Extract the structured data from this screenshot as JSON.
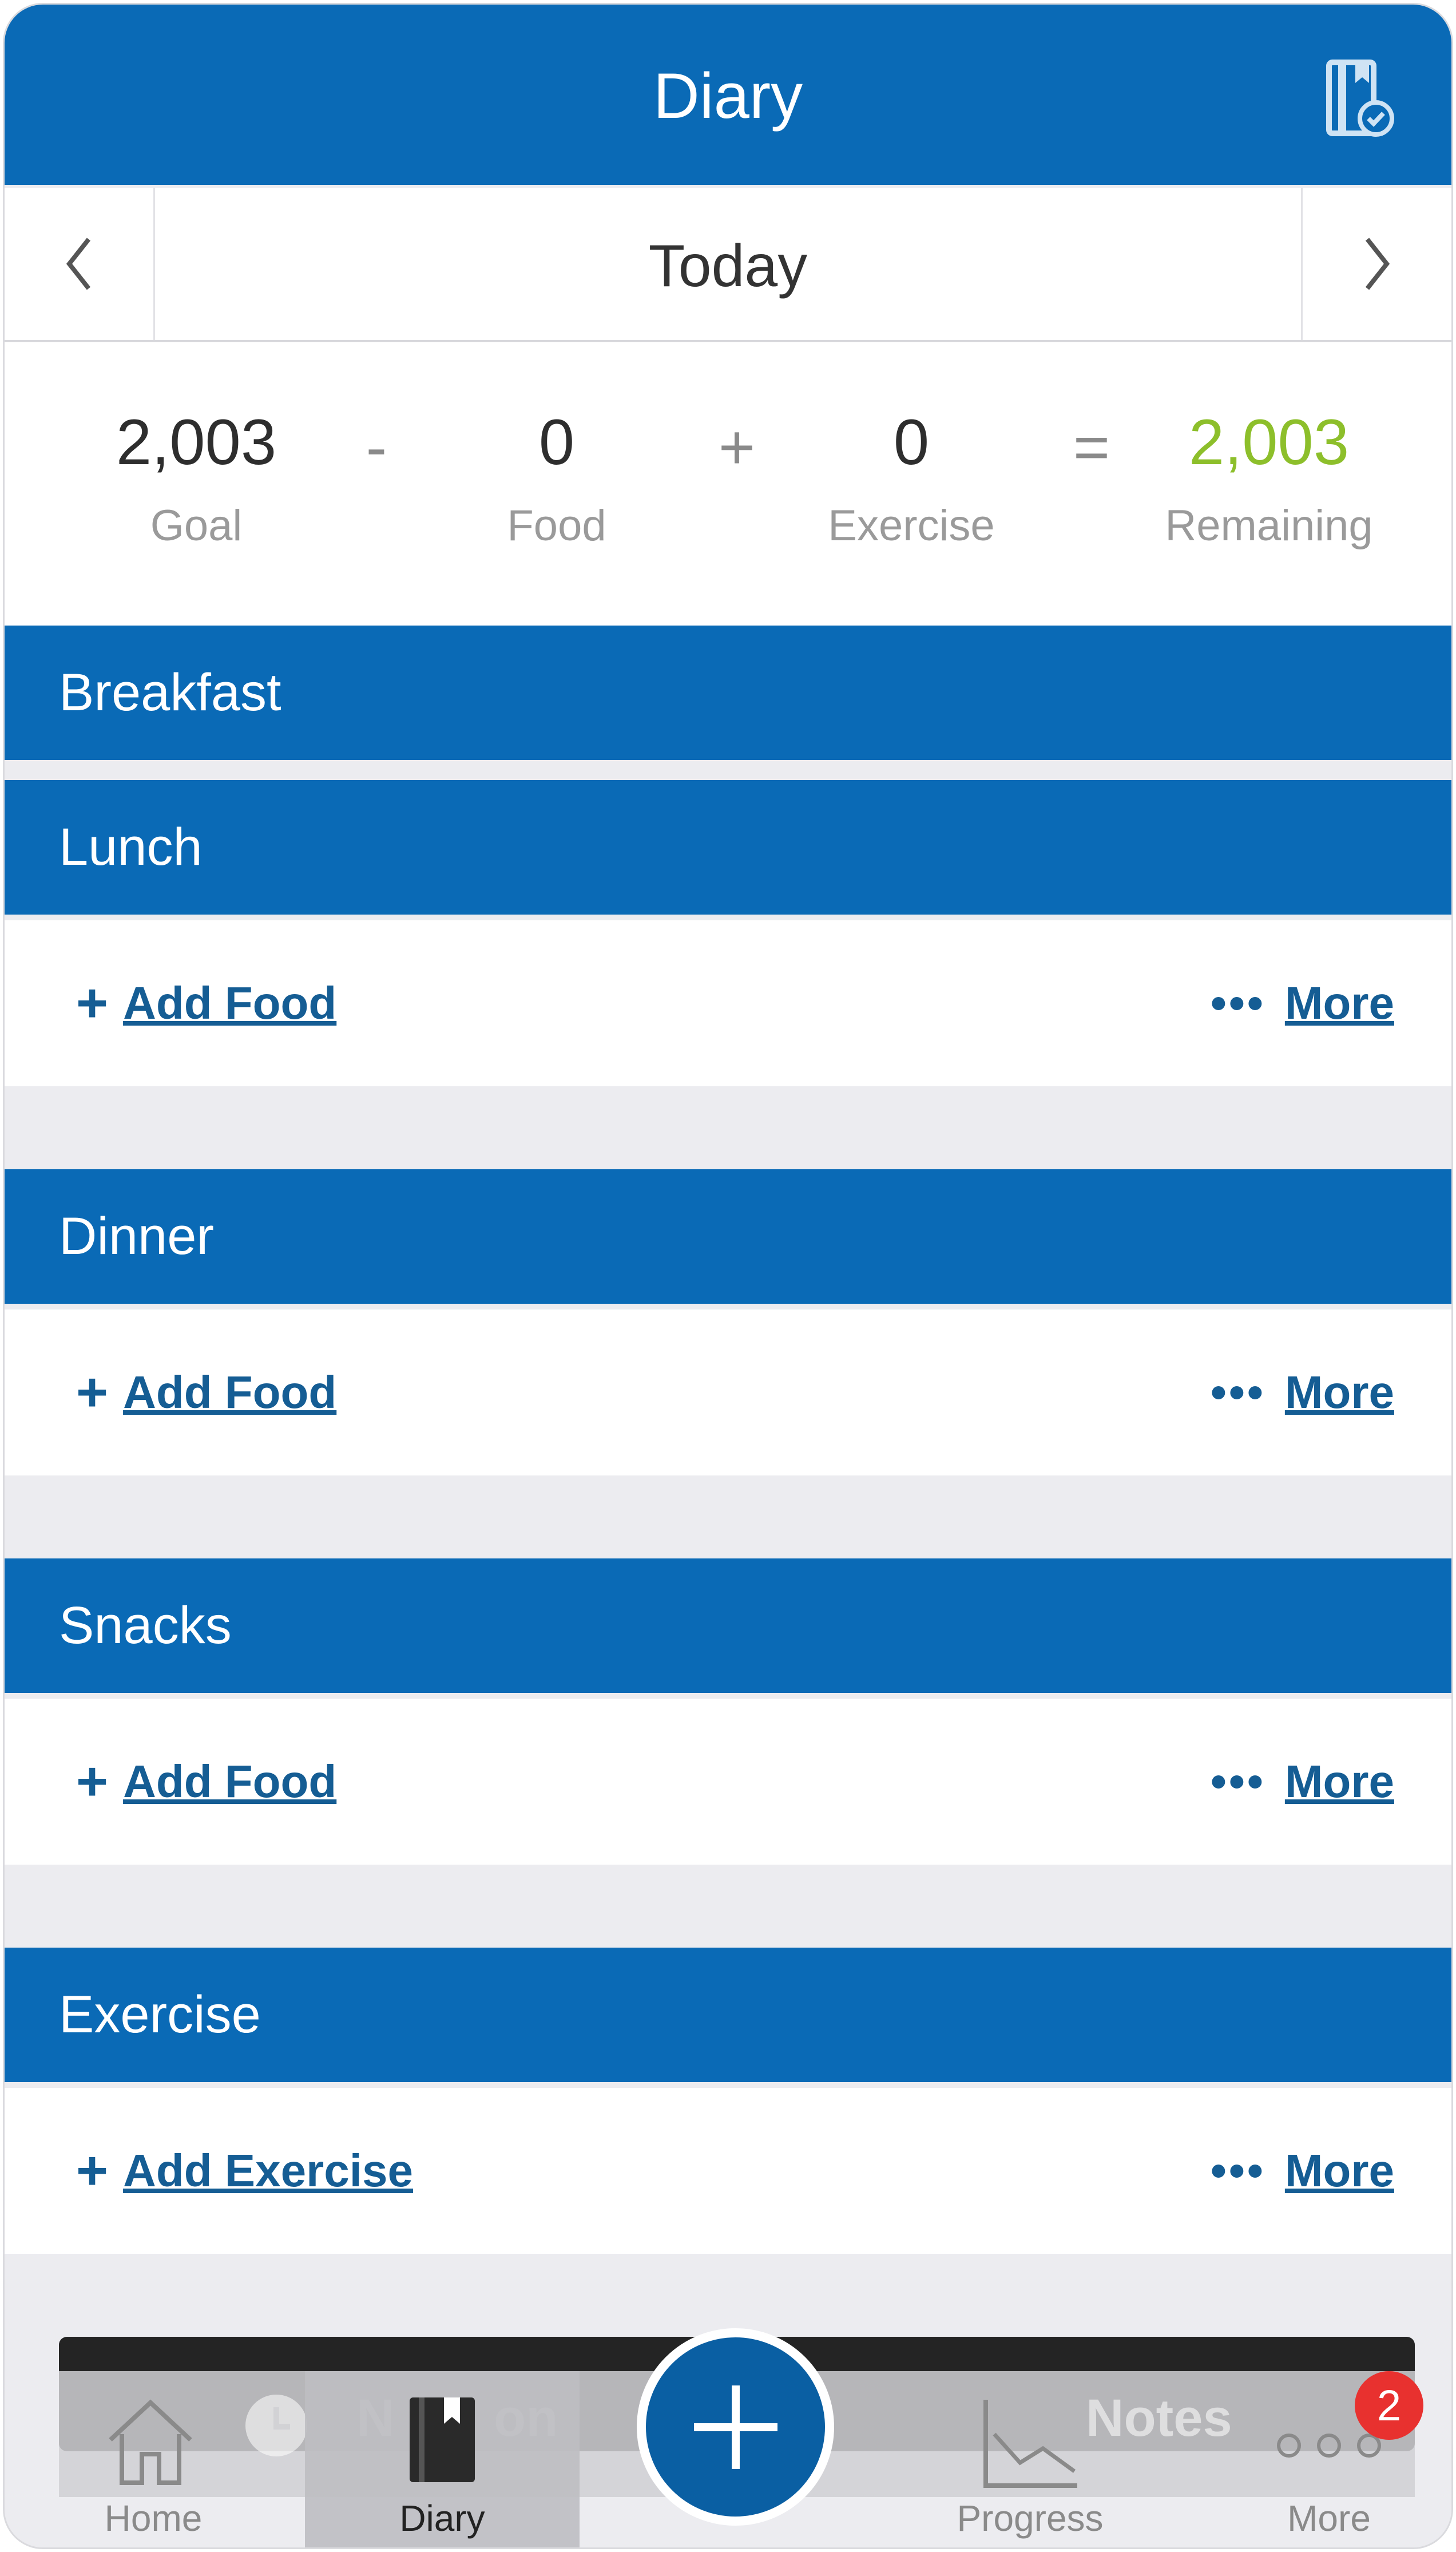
{
  "header": {
    "title": "Diary"
  },
  "date_nav": {
    "label": "Today"
  },
  "summary": {
    "goal": {
      "value": "2,003",
      "label": "Goal"
    },
    "op1": "-",
    "food": {
      "value": "0",
      "label": "Food"
    },
    "op2": "+",
    "exercise": {
      "value": "0",
      "label": "Exercise"
    },
    "op3": "=",
    "remaining": {
      "value": "2,003",
      "label": "Remaining"
    }
  },
  "sections": {
    "breakfast": "Breakfast",
    "lunch": "Lunch",
    "dinner": "Dinner",
    "snacks": "Snacks",
    "exercise": "Exercise"
  },
  "actions": {
    "plus": "+",
    "add_food": "Add Food",
    "add_exercise": "Add Exercise",
    "more_dots": "•••",
    "more": "More"
  },
  "tabbar": {
    "home": "Home",
    "diary": "Diary",
    "progress": "Progress",
    "more": "More",
    "badge_count": "2",
    "faded_left": "N",
    "faded_left2": "on",
    "faded_right": "Notes"
  },
  "colors": {
    "brand": "#0a6ab6",
    "remaining_green": "#8dbf2b",
    "link": "#155d94",
    "badge_red": "#e8312f"
  },
  "icons": [
    "diary-check-icon",
    "chevron-left-icon",
    "chevron-right-icon",
    "home-icon",
    "diary-book-icon",
    "add-plus-icon",
    "progress-chart-icon",
    "more-dots-icon",
    "clock-icon"
  ]
}
